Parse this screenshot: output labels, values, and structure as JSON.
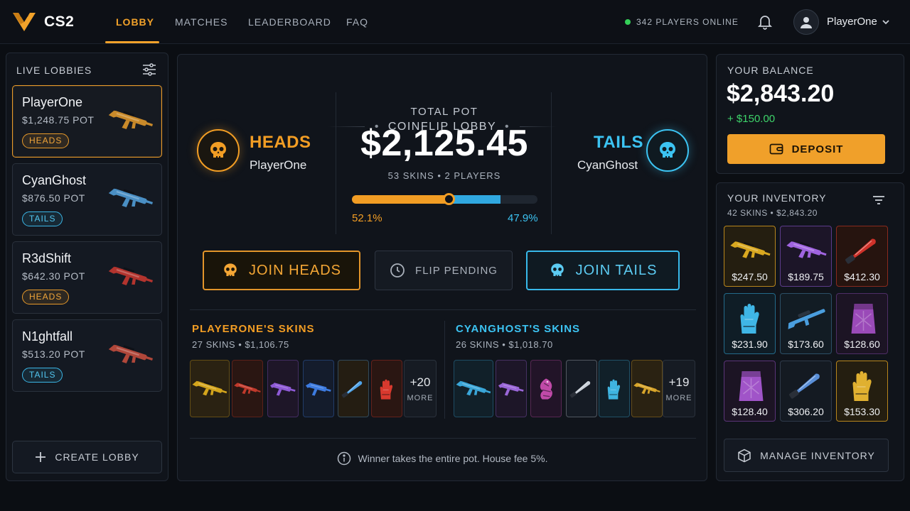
{
  "nav": {
    "brand": "CS2",
    "items": [
      "LOBBY",
      "MATCHES",
      "LEADERBOARD",
      "FAQ"
    ],
    "online_text": "342 PLAYERS ONLINE",
    "username": "PlayerOne"
  },
  "colors": {
    "heads": "#f29d24",
    "tails": "#38b9ea",
    "online": "#34d058",
    "positive": "#3ed46a"
  },
  "lobbies": {
    "title": "LIVE LOBBIES",
    "items": [
      {
        "name": "PlayerOne",
        "pot": "$1,248.75 POT",
        "side": "HEADS",
        "gun_color": "#c98a2a"
      },
      {
        "name": "CyanGhost",
        "pot": "$876.50 POT",
        "side": "TAILS",
        "gun_color": "#4a8fc4"
      },
      {
        "name": "R3dShift",
        "pot": "$642.30 POT",
        "side": "HEADS",
        "gun_color": "#b3342e"
      },
      {
        "name": "N1ghtfall",
        "pot": "$513.20 POT",
        "side": "TAILS",
        "gun_color": "#b0473a"
      }
    ],
    "create_label": "CREATE LOBBY"
  },
  "coinflip": {
    "title": "COINFLIP LOBBY",
    "heads_label": "HEADS",
    "heads_player": "PlayerOne",
    "tails_label": "TAILS",
    "tails_player": "CyanGhost",
    "pot_label": "TOTAL POT",
    "pot_value": "$2,125.45",
    "pot_meta": "53 SKINS • 2 PLAYERS",
    "heads_pct": "52.1%",
    "tails_pct": "47.9%",
    "heads_share": 0.521,
    "join_heads": "JOIN HEADS",
    "pending": "FLIP PENDING",
    "join_tails": "JOIN TAILS",
    "note": "Winner takes the entire pot. House fee 5%."
  },
  "heads_skins": {
    "title": "PLAYERONE'S SKINS",
    "meta": "27 SKINS • $1,106.75",
    "tiles": [
      {
        "icon": "rifle-icon",
        "color": "#d4a51c",
        "bg": "#2a2212"
      },
      {
        "icon": "rifle-icon",
        "color": "#c0392b",
        "bg": "#2a1612"
      },
      {
        "icon": "smg-icon",
        "color": "#8e5ad6",
        "bg": "#1e1628"
      },
      {
        "icon": "smg-icon",
        "color": "#3d7be0",
        "bg": "#141c2c"
      },
      {
        "icon": "knife-icon",
        "color": "#4fa3e8",
        "bg": "#241d12"
      },
      {
        "icon": "gloves-icon",
        "color": "#d8392e",
        "bg": "#2a1612"
      }
    ],
    "more_count": "+20",
    "more_label": "MORE"
  },
  "tails_skins": {
    "title": "CYANGHOST'S SKINS",
    "meta": "26 SKINS • $1,018.70",
    "tiles": [
      {
        "icon": "rifle-icon",
        "color": "#3aa6d8",
        "bg": "#112029"
      },
      {
        "icon": "smg-icon",
        "color": "#9a66d8",
        "bg": "#1d1628"
      },
      {
        "icon": "dragon-icon",
        "color": "#c04aa8",
        "bg": "#221428"
      },
      {
        "icon": "knife-icon",
        "color": "#c8cfd8",
        "bg": "#151b24"
      },
      {
        "icon": "gloves-icon",
        "color": "#3fb4e0",
        "bg": "#112029"
      },
      {
        "icon": "rifle-icon",
        "color": "#d8a52a",
        "bg": "#2a2212"
      }
    ],
    "more_count": "+19",
    "more_label": "MORE"
  },
  "balance": {
    "label": "YOUR BALANCE",
    "value": "$2,843.20",
    "delta": "+ $150.00",
    "deposit": "DEPOSIT"
  },
  "inventory": {
    "title": "YOUR INVENTORY",
    "meta": "42 SKINS • $2,843.20",
    "items": [
      {
        "price": "$247.50",
        "icon": "rifle-icon",
        "color": "#d9a820",
        "bg": "#241e10",
        "border": "#b8861c"
      },
      {
        "price": "$189.75",
        "icon": "rifle-icon",
        "color": "#a064e0",
        "bg": "#1c1528",
        "border": "#5c3b8a"
      },
      {
        "price": "$412.30",
        "icon": "knife-icon",
        "color": "#d0322a",
        "bg": "#26140f",
        "border": "#8a2a1e"
      },
      {
        "price": "$231.90",
        "icon": "gloves-icon",
        "color": "#3fb6e6",
        "bg": "#0f1d26",
        "border": "#236a8a"
      },
      {
        "price": "$173.60",
        "icon": "sniper-icon",
        "color": "#4a9ede",
        "bg": "#121c24",
        "border": "#2c4f66"
      },
      {
        "price": "$128.60",
        "icon": "case-icon",
        "color": "#9a4ab8",
        "bg": "#1c1424",
        "border": "#4e2e66"
      },
      {
        "price": "$128.40",
        "icon": "case-icon",
        "color": "#a054c8",
        "bg": "#1c1424",
        "border": "#5a3478"
      },
      {
        "price": "$306.20",
        "icon": "knife-icon",
        "color": "#5a8fd8",
        "bg": "#141a22",
        "border": "#2f3a4a"
      },
      {
        "price": "$153.30",
        "icon": "gloves-icon",
        "color": "#e0b030",
        "bg": "#241e10",
        "border": "#b8861c"
      }
    ],
    "manage": "MANAGE INVENTORY"
  }
}
